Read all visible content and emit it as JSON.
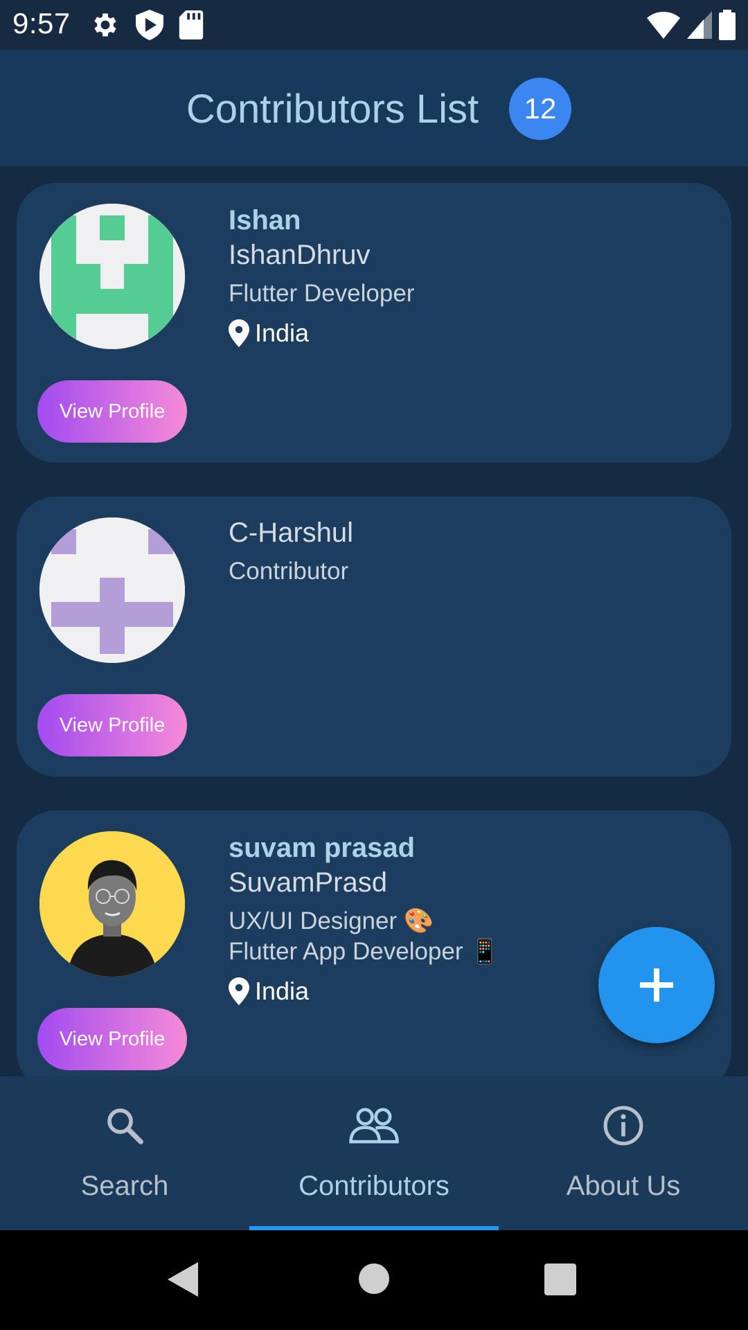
{
  "status_bar": {
    "time": "9:57",
    "icons_left": [
      "gear-icon",
      "shield-play-icon",
      "sd-card-icon"
    ],
    "icons_right": [
      "wifi-icon",
      "cell-signal-icon",
      "battery-icon"
    ]
  },
  "header": {
    "title": "Contributors List",
    "count": "12"
  },
  "contributors": [
    {
      "name": "Ishan",
      "username": "IshanDhruv",
      "role": "Flutter Developer",
      "location": "India",
      "button_label": "View Profile"
    },
    {
      "name": "",
      "username": "C-Harshul",
      "role": "Contributor",
      "location": "",
      "button_label": "View Profile"
    },
    {
      "name": "suvam prasad",
      "username": "SuvamPrasd",
      "role_line1": "UX/UI Designer 🎨",
      "role_line2": "Flutter App Developer 📱",
      "location": "India",
      "button_label": "View Profile"
    }
  ],
  "fab": {
    "icon": "plus-icon"
  },
  "bottom_nav": {
    "items": [
      {
        "label": "Search",
        "icon": "search-icon"
      },
      {
        "label": "Contributors",
        "icon": "people-icon",
        "active": true
      },
      {
        "label": "About Us",
        "icon": "info-icon"
      }
    ]
  },
  "colors": {
    "background": "#152a43",
    "app_bar": "#183a5a",
    "card": "#1c3d5e",
    "accent": "#2394ee",
    "title": "#a9d3ea",
    "button_gradient_start": "#a24bf0",
    "button_gradient_end": "#f68ad8"
  }
}
